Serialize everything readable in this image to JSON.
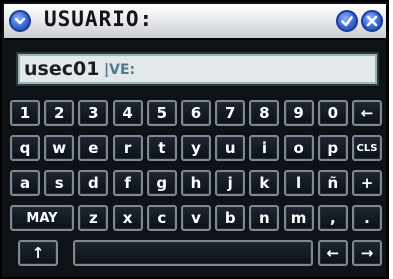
{
  "title": {
    "text": "USUARIO:",
    "menu_icon": "chevron-down-circle-icon",
    "confirm_icon": "checkmark-circle-icon",
    "close_icon": "x-circle-icon"
  },
  "field": {
    "value": "usec01",
    "hint": "VE:"
  },
  "keyboard": {
    "row1": [
      "1",
      "2",
      "3",
      "4",
      "5",
      "6",
      "7",
      "8",
      "9",
      "0",
      "←"
    ],
    "row2": [
      "q",
      "w",
      "e",
      "r",
      "t",
      "y",
      "u",
      "i",
      "o",
      "p",
      "CLS"
    ],
    "row3": [
      "a",
      "s",
      "d",
      "f",
      "g",
      "h",
      "j",
      "k",
      "l",
      "ñ",
      "+"
    ],
    "row4": [
      "MAY",
      "z",
      "x",
      "c",
      "v",
      "b",
      "n",
      "m",
      ",",
      "."
    ],
    "row5": [
      "↑",
      "",
      "←",
      "→"
    ]
  },
  "colors": {
    "window": "#0e1116",
    "accent": "#3a66d6"
  }
}
